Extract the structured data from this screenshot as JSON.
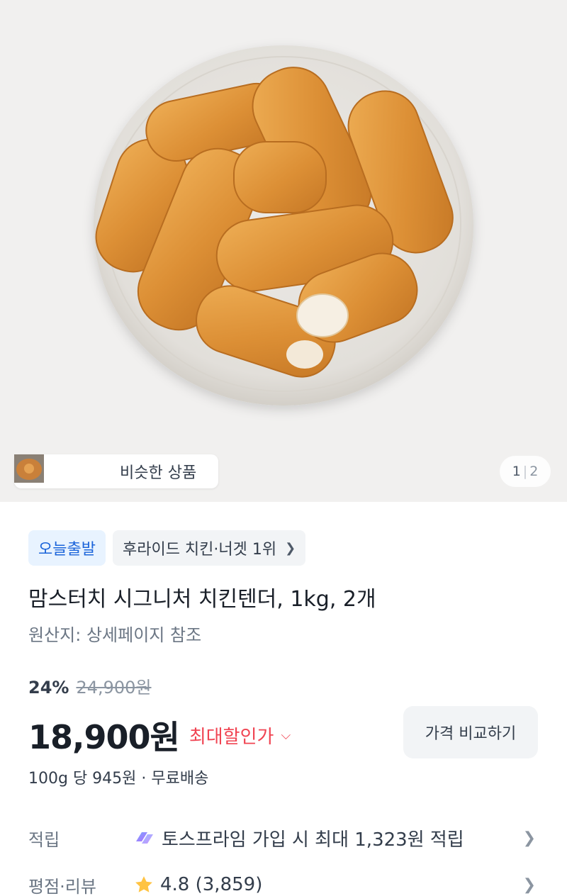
{
  "gallery": {
    "similar_label": "비슷한 상품",
    "page_current": "1",
    "page_total": "2"
  },
  "badges": {
    "delivery": "오늘출발",
    "ranking": "후라이드 치킨·너겟 1위"
  },
  "product": {
    "title": "맘스터치 시그니처 치킨텐더, 1kg, 2개",
    "origin": "원산지: 상세페이지 참조"
  },
  "pricing": {
    "discount_rate": "24%",
    "original_price": "24,900원",
    "price": "18,900원",
    "max_discount_label": "최대할인가",
    "compare_button": "가격 비교하기",
    "unit_info": "100g 당 945원 · 무료배송"
  },
  "rows": {
    "points_label": "적립",
    "points_value": "토스프라임 가입 시 최대 1,323원 적립",
    "review_label": "평점·리뷰",
    "review_value": "4.8 (3,859)"
  },
  "colors": {
    "accent_blue": "#1b64da",
    "discount_red": "#f04452",
    "star_yellow": "#ffc342"
  },
  "icons": {
    "ranking_chevron": "chevron-right-icon",
    "max_discount_chevron": "chevron-down-icon",
    "points_icon": "toss-prime-icon",
    "rating_icon": "star-icon"
  }
}
